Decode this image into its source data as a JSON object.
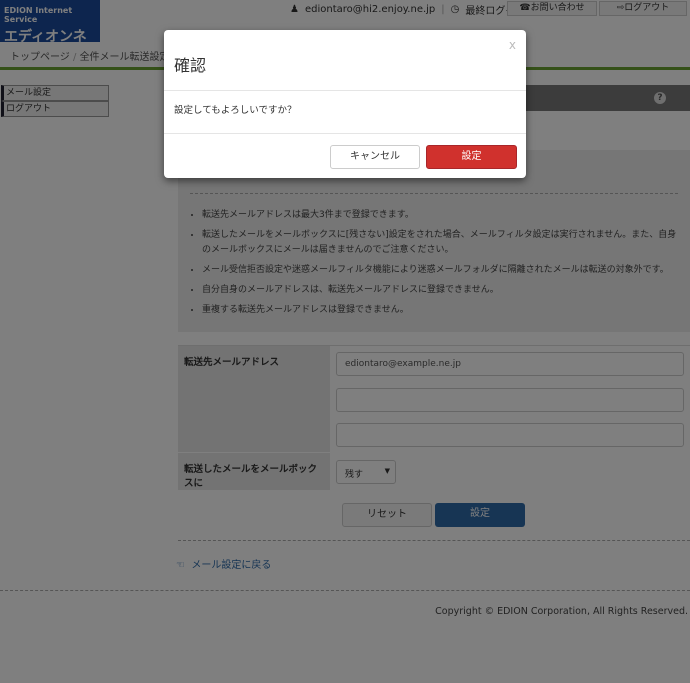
{
  "header": {
    "logo_line1": "EDION Internet Service",
    "logo_line2": "エディオンネット",
    "user": "ediontaro@hi2.enjoy.ne.jp",
    "last_login_label": "最終ログイン：",
    "last_login_value": "-",
    "contact_button": "お問い合わせ",
    "logout_button": "ログアウト"
  },
  "breadcrumb": {
    "home": "トップページ",
    "separator": "/",
    "current": "全件メール転送設定"
  },
  "sidebar": {
    "items": [
      {
        "label": "メール設定"
      },
      {
        "label": "ログアウト"
      }
    ]
  },
  "section": {
    "help_icon": "?"
  },
  "notes": [
    "転送先メールアドレスは最大3件まで登録できます。",
    "転送したメールをメールボックスに[残さない]設定をされた場合、メールフィルタ設定は実行されません。また、自身のメールボックスにメールは届きませんのでご注意ください。",
    "メール受信拒否設定や迷惑メールフィルタ機能により迷惑メールフォルダに隔離されたメールは転送の対象外です。",
    "自分自身のメールアドレスは、転送先メールアドレスに登録できません。",
    "重複する転送先メールアドレスは登録できません。"
  ],
  "form": {
    "address_label": "転送先メールアドレス",
    "addresses": [
      "ediontaro@example.ne.jp",
      "",
      ""
    ],
    "keep_label": "転送したメールをメールボックスに",
    "keep_value": "残す",
    "reset_button": "リセット",
    "submit_button": "設定"
  },
  "back_link": "メール設定に戻る",
  "footer": {
    "copyright": "Copyright © EDION Corporation, All Rights Reserved."
  },
  "modal": {
    "title": "確認",
    "close": "x",
    "message": "設定してもよろしいですか？",
    "cancel_button": "キャンセル",
    "confirm_button": "設定"
  },
  "colors": {
    "brand": "#1a4a9c",
    "accent_green": "#6aa232",
    "confirm_red": "#d0312d",
    "submit_blue": "#2f6aa8"
  }
}
